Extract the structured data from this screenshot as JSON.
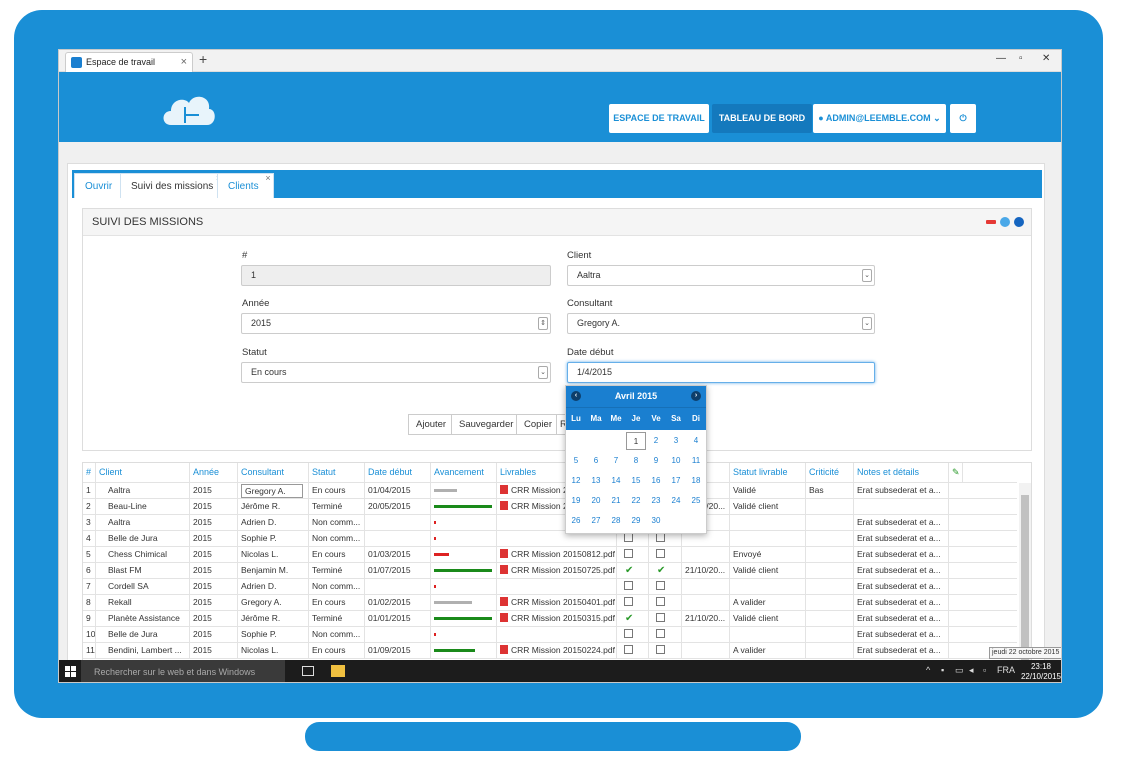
{
  "browser": {
    "tab_title": "Espace de travail",
    "tab_close": "×",
    "new_tab": "+"
  },
  "nav": {
    "workspace": "ESPACE DE TRAVAIL",
    "dashboard": "TABLEAU DE BORD",
    "user": "ADMIN@LEEMBLE.COM",
    "power": "⏻"
  },
  "tabs": [
    {
      "label": "Ouvrir"
    },
    {
      "label": "Suivi des missions"
    },
    {
      "label": "Clients"
    }
  ],
  "panel": {
    "title": "SUIVI DES MISSIONS",
    "labels": {
      "id": "#",
      "client": "Client",
      "year": "Année",
      "consultant": "Consultant",
      "status": "Statut",
      "start_date": "Date début"
    },
    "values": {
      "id": "1",
      "client": "Aaltra",
      "year": "2015",
      "consultant": "Gregory A.",
      "status": "En cours",
      "start_date": "1/4/2015"
    },
    "actions": [
      "Ajouter",
      "Sauvegarder",
      "Copier",
      "R"
    ]
  },
  "calendar": {
    "month": "Avril 2015",
    "dow": [
      "Lu",
      "Ma",
      "Me",
      "Je",
      "Ve",
      "Sa",
      "Di"
    ],
    "days": [
      [
        "",
        "",
        "",
        "1",
        "2",
        "3",
        "4",
        "5"
      ],
      [
        "6",
        "7",
        "8",
        "9",
        "10",
        "11",
        "12"
      ],
      [
        "13",
        "14",
        "15",
        "16",
        "17",
        "18",
        "19"
      ],
      [
        "20",
        "21",
        "22",
        "23",
        "24",
        "25",
        "26"
      ],
      [
        "27",
        "28",
        "29",
        "30",
        "",
        "",
        ""
      ]
    ]
  },
  "grid": {
    "headers": [
      "#",
      "Client",
      "Année",
      "Consultant",
      "Statut",
      "Date début",
      "Avancement",
      "Livrables",
      "",
      "",
      "e fin",
      "Statut livrable",
      "Criticité",
      "Notes et détails"
    ],
    "rows": [
      {
        "n": "1",
        "client": "Aaltra",
        "year": "2015",
        "consultant": "Gregory A.",
        "status": "En cours",
        "start": "01/04/2015",
        "progress": 0.4,
        "color": "#b0b0b0",
        "deliv": "CRR Mission 2",
        "c1": "",
        "c2": "",
        "end": "",
        "sl": "Validé",
        "crit": "Bas",
        "notes": "Erat subsederat et a..."
      },
      {
        "n": "2",
        "client": "Beau-Line",
        "year": "2015",
        "consultant": "Jérôme R.",
        "status": "Terminé",
        "start": "20/05/2015",
        "progress": 1,
        "color": "#1a8a1a",
        "deliv": "CRR Mission 2",
        "c1": "",
        "c2": "",
        "end": "21/10/20...",
        "sl": "Validé client",
        "crit": "",
        "notes": ""
      },
      {
        "n": "3",
        "client": "Aaltra",
        "year": "2015",
        "consultant": "Adrien D.",
        "status": "Non comm...",
        "start": "",
        "progress": 0.02,
        "color": "#d22",
        "deliv": "",
        "c1": "",
        "c2": "",
        "end": "",
        "sl": "",
        "crit": "",
        "notes": "Erat subsederat et a..."
      },
      {
        "n": "4",
        "client": "Belle de Jura",
        "year": "2015",
        "consultant": "Sophie P.",
        "status": "Non comm...",
        "start": "",
        "progress": 0.02,
        "color": "#d22",
        "deliv": "",
        "c1": "box",
        "c2": "box",
        "end": "",
        "sl": "",
        "crit": "",
        "notes": "Erat subsederat et a..."
      },
      {
        "n": "5",
        "client": "Chess Chimical",
        "year": "2015",
        "consultant": "Nicolas L.",
        "status": "En cours",
        "start": "01/03/2015",
        "progress": 0.25,
        "color": "#d22",
        "deliv": "CRR Mission 20150812.pdf",
        "c1": "box",
        "c2": "box",
        "end": "",
        "sl": "Envoyé",
        "crit": "",
        "notes": "Erat subsederat et a..."
      },
      {
        "n": "6",
        "client": "Blast FM",
        "year": "2015",
        "consultant": "Benjamin M.",
        "status": "Terminé",
        "start": "01/07/2015",
        "progress": 1,
        "color": "#1a8a1a",
        "deliv": "CRR Mission 20150725.pdf",
        "c1": "check",
        "c2": "check",
        "end": "21/10/20...",
        "sl": "Validé client",
        "crit": "",
        "notes": "Erat subsederat et a..."
      },
      {
        "n": "7",
        "client": "Cordell SA",
        "year": "2015",
        "consultant": "Adrien D.",
        "status": "Non comm...",
        "start": "",
        "progress": 0.02,
        "color": "#d22",
        "deliv": "",
        "c1": "box",
        "c2": "box",
        "end": "",
        "sl": "",
        "crit": "",
        "notes": "Erat subsederat et a..."
      },
      {
        "n": "8",
        "client": "Rekall",
        "year": "2015",
        "consultant": "Gregory A.",
        "status": "En cours",
        "start": "01/02/2015",
        "progress": 0.65,
        "color": "#b0b0b0",
        "deliv": "CRR Mission 20150401.pdf",
        "c1": "box",
        "c2": "box",
        "end": "",
        "sl": "A valider",
        "crit": "",
        "notes": "Erat subsederat et a..."
      },
      {
        "n": "9",
        "client": "Planète Assistance",
        "year": "2015",
        "consultant": "Jérôme R.",
        "status": "Terminé",
        "start": "01/01/2015",
        "progress": 1,
        "color": "#1a8a1a",
        "deliv": "CRR Mission 20150315.pdf",
        "c1": "check",
        "c2": "box",
        "end": "21/10/20...",
        "sl": "Validé client",
        "crit": "",
        "notes": "Erat subsederat et a..."
      },
      {
        "n": "10",
        "client": "Belle de Jura",
        "year": "2015",
        "consultant": "Sophie P.",
        "status": "Non comm...",
        "start": "",
        "progress": 0.02,
        "color": "#d22",
        "deliv": "",
        "c1": "box",
        "c2": "box",
        "end": "",
        "sl": "",
        "crit": "",
        "notes": "Erat subsederat et a..."
      },
      {
        "n": "11",
        "client": "Bendini, Lambert ...",
        "year": "2015",
        "consultant": "Nicolas L.",
        "status": "En cours",
        "start": "01/09/2015",
        "progress": 0.7,
        "color": "#1a8a1a",
        "deliv": "CRR Mission 20150224.pdf",
        "c1": "box",
        "c2": "box",
        "end": "",
        "sl": "A valider",
        "crit": "",
        "notes": "Erat subsederat et a..."
      }
    ]
  },
  "taskbar": {
    "search_placeholder": "Rechercher sur le web et dans Windows",
    "lang": "FRA",
    "time": "23:18",
    "date": "22/10/2015",
    "tooltip": "jeudi 22 octobre 2015"
  }
}
